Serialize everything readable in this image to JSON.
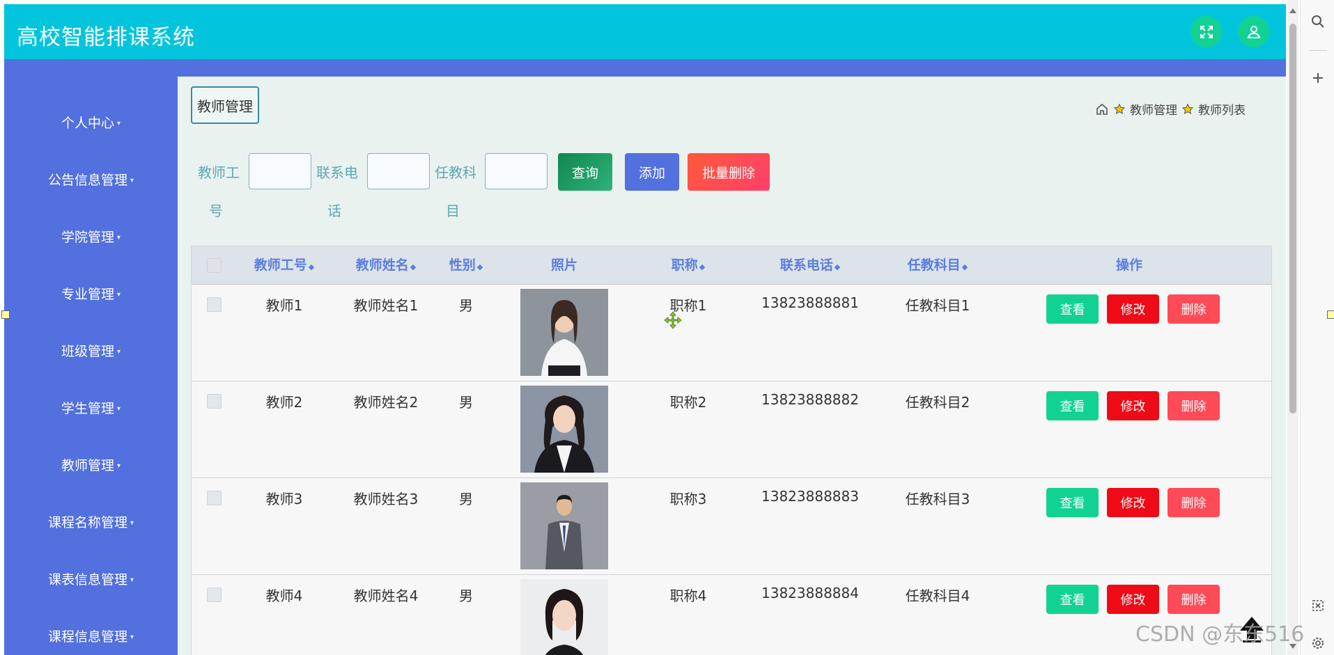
{
  "header": {
    "title": "高校智能排课系统"
  },
  "sidebar": {
    "items": [
      {
        "label": "个人中心"
      },
      {
        "label": "公告信息管理"
      },
      {
        "label": "学院管理"
      },
      {
        "label": "专业管理"
      },
      {
        "label": "班级管理"
      },
      {
        "label": "学生管理"
      },
      {
        "label": "教师管理"
      },
      {
        "label": "课程名称管理"
      },
      {
        "label": "课表信息管理"
      },
      {
        "label": "课程信息管理"
      }
    ]
  },
  "page": {
    "tag": "教师管理",
    "breadcrumb": [
      "教师管理",
      "教师列表"
    ]
  },
  "search": {
    "fields": [
      {
        "label_line1": "教师工",
        "label_line2": "号",
        "value": ""
      },
      {
        "label_line1": "联系电",
        "label_line2": "话",
        "value": ""
      },
      {
        "label_line1": "任教科",
        "label_line2": "目",
        "value": ""
      }
    ],
    "query_label": "查询",
    "add_label": "添加",
    "batch_delete_label": "批量删除"
  },
  "table": {
    "columns": [
      "教师工号",
      "教师姓名",
      "性别",
      "照片",
      "职称",
      "联系电话",
      "任教科目",
      "操作"
    ],
    "rows": [
      {
        "id": "教师1",
        "name": "教师姓名1",
        "gender": "男",
        "title": "职称1",
        "phone": "13823888881",
        "subject": "任教科目1"
      },
      {
        "id": "教师2",
        "name": "教师姓名2",
        "gender": "男",
        "title": "职称2",
        "phone": "13823888882",
        "subject": "任教科目2"
      },
      {
        "id": "教师3",
        "name": "教师姓名3",
        "gender": "男",
        "title": "职称3",
        "phone": "13823888883",
        "subject": "任教科目3"
      },
      {
        "id": "教师4",
        "name": "教师姓名4",
        "gender": "男",
        "title": "职称4",
        "phone": "13823888884",
        "subject": "任教科目4"
      }
    ],
    "actions": {
      "view": "查看",
      "edit": "修改",
      "delete": "删除"
    }
  },
  "watermark": "CSDN @东东516",
  "colors": {
    "topbar": "#02c5dd",
    "sidebar": "#5270de",
    "content_bg": "#e9f2ef",
    "query": "#1ea36b",
    "add": "#5270de",
    "batch_delete": "#ff4a4a",
    "view": "#12d293",
    "edit": "#ee0a16",
    "delete": "#ff4a57"
  }
}
